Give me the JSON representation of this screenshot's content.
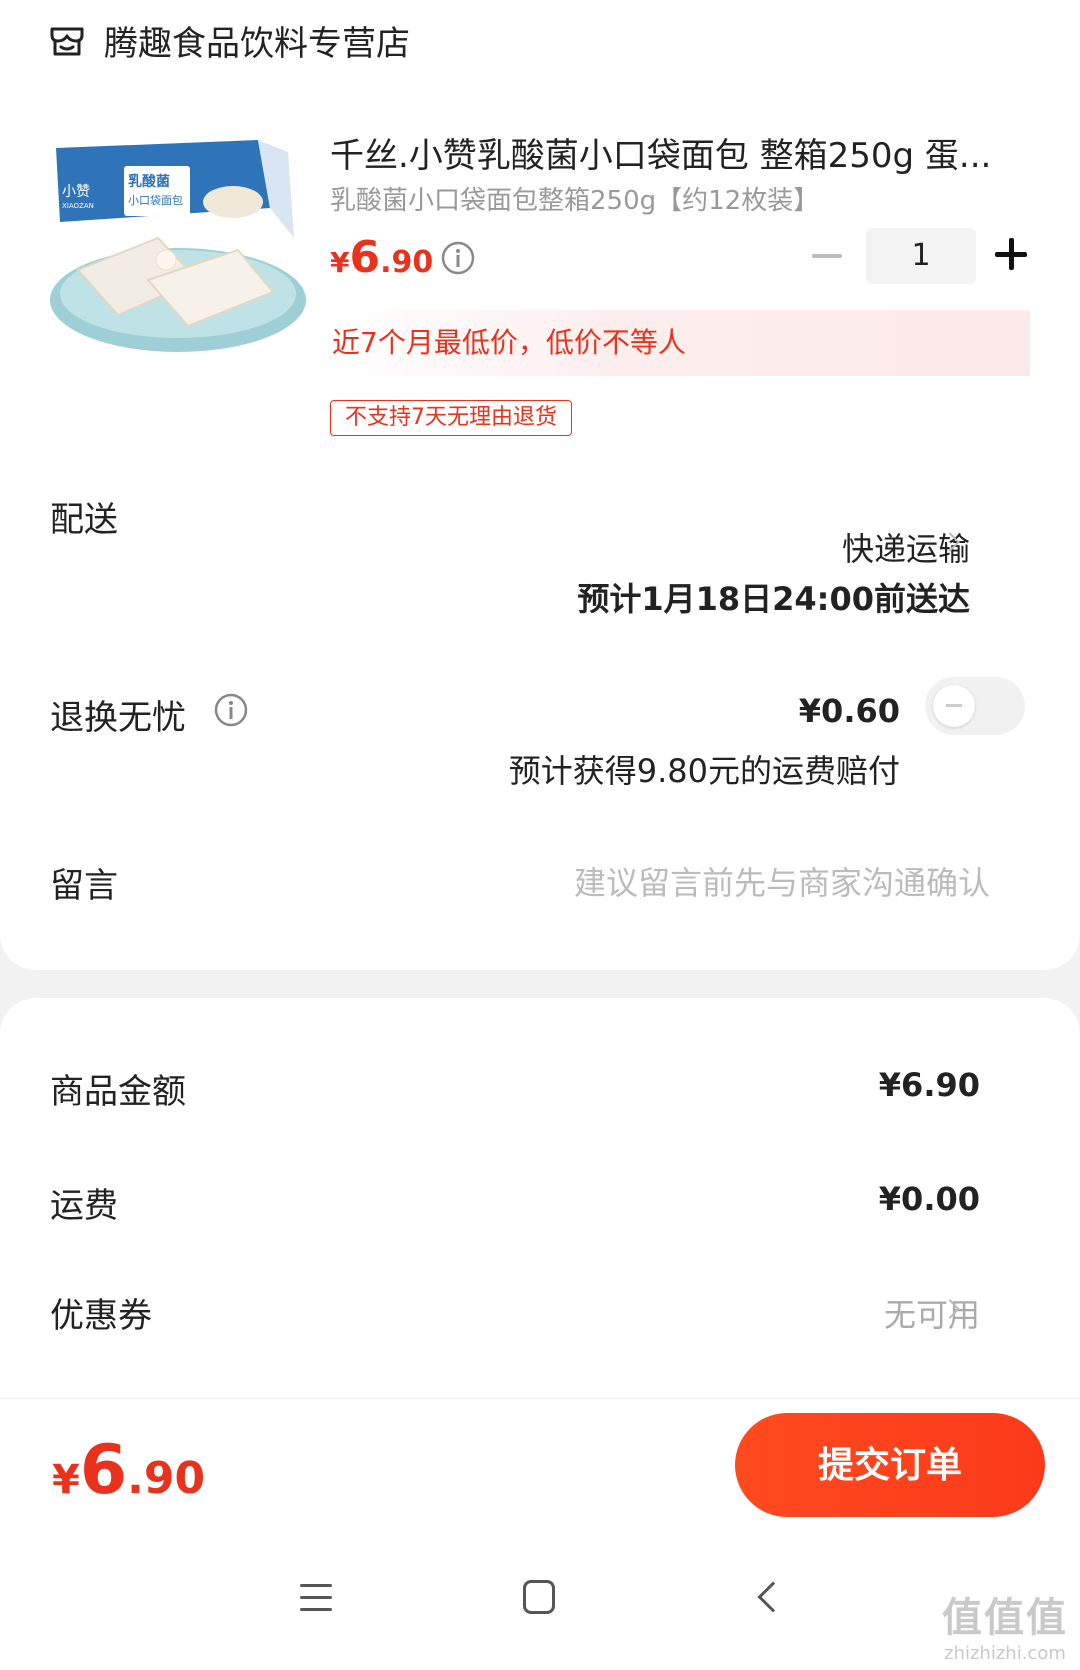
{
  "shop": {
    "name": "腾趣食品饮料专营店"
  },
  "product": {
    "title": "千丝.小赞乳酸菌小口袋面包 整箱250g 蛋...",
    "sku": "乳酸菌小口袋面包整箱250g【约12枚装】",
    "price": {
      "currency": "¥",
      "integer": "6",
      "decimal": ".90"
    },
    "quantity": "1",
    "lowest_price_note": "近7个月最低价，低价不等人",
    "return_badge": "不支持7天无理由退货",
    "image_text": {
      "brand": "小赞",
      "brand_en": "XIAOZAN",
      "name": "乳酸菌",
      "sub": "小口袋面包"
    }
  },
  "shipping": {
    "label": "配送",
    "method": "快递运输",
    "eta": "预计1月18日24:00前送达"
  },
  "returns": {
    "label": "退换无忧",
    "price": "¥0.60",
    "note": "预计获得9.80元的运费赔付",
    "enabled": false
  },
  "message": {
    "label": "留言",
    "placeholder": "建议留言前先与商家沟通确认"
  },
  "summary": {
    "goods_label": "商品金额",
    "goods_value": "¥6.90",
    "freight_label": "运费",
    "freight_value": "¥0.00",
    "coupon_label": "优惠券",
    "coupon_value": "无可用"
  },
  "footer": {
    "total": {
      "currency": "¥",
      "integer": "6",
      "decimal": ".90"
    },
    "submit_label": "提交订单"
  },
  "watermark": {
    "big": "值值值",
    "small": "zhizhizhi.com"
  },
  "colors": {
    "accent": "#e8321d",
    "submit": "#fb3a1a"
  }
}
